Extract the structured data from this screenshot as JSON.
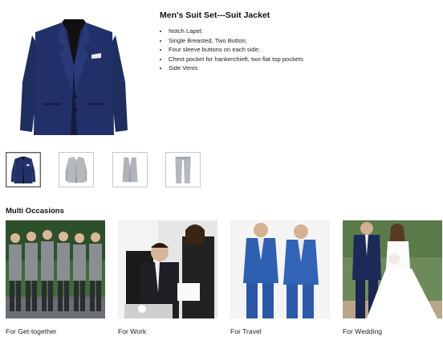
{
  "product": {
    "title": "Men's Suit Set---Suit Jacket",
    "features": [
      "Notch Lapel;",
      "Single Breasted, Two Button;",
      "Four sleeve buttons on each side;",
      "Chest pocket for hankerchieft, two flat top pockets",
      "Side Vents"
    ]
  },
  "thumbnails": [
    {
      "name": "navy-jacket",
      "selected": true
    },
    {
      "name": "grey-jacket",
      "selected": false
    },
    {
      "name": "grey-vest",
      "selected": false
    },
    {
      "name": "grey-pants",
      "selected": false
    }
  ],
  "occasions": {
    "title": "Multi Occasions",
    "items": [
      {
        "caption": "For Get-together"
      },
      {
        "caption": "For Work"
      },
      {
        "caption": "For Travel"
      },
      {
        "caption": "For Wedding"
      }
    ]
  },
  "colors": {
    "navy": "#1c2a5a",
    "royal_blue": "#2f5fb0",
    "grey_suit": "#a3a7ad",
    "thumb_border": "#c9c9c9"
  }
}
